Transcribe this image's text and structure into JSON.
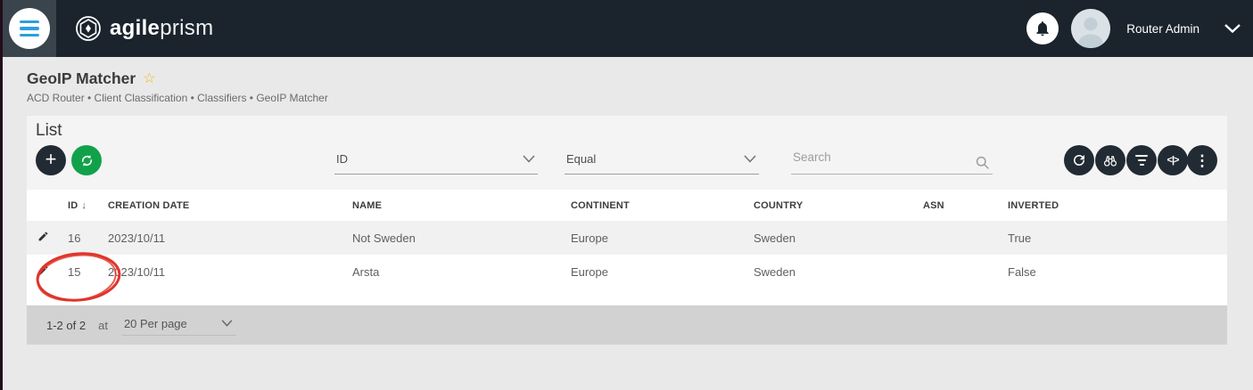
{
  "navbar": {
    "brand_primary": "agile",
    "brand_secondary": "prism",
    "user_name": "Router Admin"
  },
  "page": {
    "title": "GeoIP Matcher",
    "breadcrumb": "ACD Router • Client Classification • Classifiers • GeoIP Matcher"
  },
  "list": {
    "heading": "List",
    "filter": {
      "field_value": "ID",
      "operator_value": "Equal",
      "search_placeholder": "Search"
    },
    "table": {
      "columns": [
        "ID",
        "CREATION DATE",
        "NAME",
        "CONTINENT",
        "COUNTRY",
        "ASN",
        "INVERTED"
      ],
      "rows": [
        {
          "id": "16",
          "creation_date": "2023/10/11",
          "name": "Not Sweden",
          "continent": "Europe",
          "country": "Sweden",
          "asn": "",
          "inverted": "True"
        },
        {
          "id": "15",
          "creation_date": "2023/10/11",
          "name": "Arsta",
          "continent": "Europe",
          "country": "Sweden",
          "asn": "",
          "inverted": "False"
        }
      ]
    },
    "pagination": {
      "range": "1-2 of 2",
      "at_label": "at",
      "per_page": "20 Per page"
    }
  },
  "icons": {
    "plus": "+",
    "sort_desc": "↓",
    "more_vertical": "⋮",
    "code": "<|>",
    "star": "☆"
  },
  "colors": {
    "navbar_bg": "#1b242d",
    "accent_blue": "#2d9fd9",
    "green_button": "#12a14b",
    "dark_button": "#222b33",
    "annotation_red": "#e0352b",
    "star_gold": "#f1b80e",
    "footer_bg": "#d2d2d2"
  }
}
